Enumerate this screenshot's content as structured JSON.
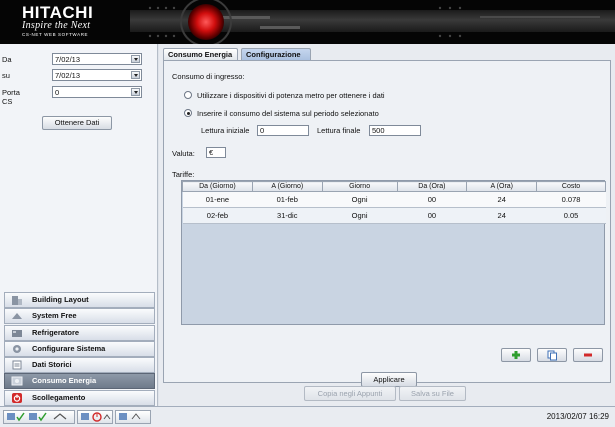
{
  "header": {
    "logo": "HITACHI",
    "tagline": "Inspire the Next",
    "software": "CS-NET WEB SOFTWARE"
  },
  "sidebar": {
    "from_label": "Da",
    "from_value": "7/02/13",
    "to_label": "su",
    "to_value": "7/02/13",
    "port_label": "Porta CS",
    "port_value": "0",
    "get_data_button": "Ottenere Dati",
    "nav": [
      {
        "label": "Building Layout",
        "icon": "building-icon"
      },
      {
        "label": "System Free",
        "icon": "system-icon"
      },
      {
        "label": "Refrigeratore",
        "icon": "chiller-icon"
      },
      {
        "label": "Configurare Sistema",
        "icon": "config-icon"
      },
      {
        "label": "Dati Storici",
        "icon": "history-icon"
      },
      {
        "label": "Consumo Energia",
        "icon": "energy-icon",
        "active": true
      },
      {
        "label": "Scollegamento",
        "icon": "power-icon"
      }
    ]
  },
  "main": {
    "tabs": [
      {
        "label": "Consumo Energia"
      },
      {
        "label": "Configurazione",
        "active": true
      }
    ],
    "input_heading": "Consumo di ingresso:",
    "radio_metering": "Utilizzare i dispositivi di potenza metro per ottenere i dati",
    "radio_manual": "Inserire il consumo del sistema sul periodo selezionato",
    "initial_reading_label": "Lettura iniziale",
    "initial_reading_value": "0",
    "final_reading_label": "Lettura finale",
    "final_reading_value": "500",
    "currency_label": "Valuta:",
    "currency_value": "€",
    "tariffs_label": "Tariffe:",
    "table": {
      "headers": [
        "Da (Giorno)",
        "A (Giorno)",
        "Giorno",
        "Da (Ora)",
        "A (Ora)",
        "Costo"
      ],
      "rows": [
        [
          "01-ene",
          "01-feb",
          "Ogni",
          "00",
          "24",
          "0.078"
        ],
        [
          "02-feb",
          "31-dic",
          "Ogni",
          "00",
          "24",
          "0.05"
        ]
      ]
    },
    "apply_button": "Applicare",
    "copy_button": "Copia negli Appunti",
    "save_button": "Salva su File"
  },
  "statusbar": {
    "datetime": "2013/02/07 16:29"
  },
  "colors": {
    "header_bg": "#050505",
    "orb_red": "#d10e0e",
    "active_nav": "#7a8595",
    "add_green": "#2f9e2f",
    "remove_red": "#d22a2a"
  }
}
